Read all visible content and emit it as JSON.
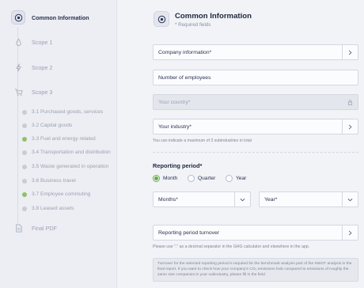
{
  "sidebar": {
    "steps": [
      {
        "label": "Common Information",
        "icon": "target-icon",
        "active": true
      },
      {
        "label": "Scope 1",
        "icon": "drop-icon",
        "active": false
      },
      {
        "label": "Scope 2",
        "icon": "lightning-icon",
        "active": false
      },
      {
        "label": "Scope 3",
        "icon": "cart-icon",
        "active": false
      },
      {
        "label": "Final PDF",
        "icon": "document-icon",
        "active": false
      }
    ],
    "scope3_items": [
      {
        "label": "3.1 Purchased goods, services",
        "done": false
      },
      {
        "label": "3.2 Capital goods",
        "done": false
      },
      {
        "label": "3.3 Fuel and energy related",
        "done": true
      },
      {
        "label": "3.4 Transportation and distribution",
        "done": false
      },
      {
        "label": "3.5 Waste generated in operation",
        "done": false
      },
      {
        "label": "3.6 Business travel",
        "done": false
      },
      {
        "label": "3.7 Employee commuting",
        "done": true
      },
      {
        "label": "3.8 Leased assets",
        "done": false
      }
    ]
  },
  "header": {
    "title": "Common Information",
    "subtitle": "* Required fields"
  },
  "form": {
    "company_info": "Company information*",
    "employees_placeholder": "Number of employees",
    "country_placeholder": "Your country*",
    "industry": "Your industry*",
    "industry_hint": "You can indicate a maximum of 3 subindustries in total",
    "period_title": "Reporting period*",
    "period_options": [
      "Month",
      "Quarter",
      "Year"
    ],
    "period_selected": "Month",
    "months_label": "Months*",
    "year_label": "Year*",
    "turnover": "Reporting period turnover",
    "turnover_hint": "Please use \".\" as a decimal separator in the GHG calculator and elsewhere in the app.",
    "note": "Turnover for the selected reporting period is required for the benchmark analysis part of the SWOT analysis in the final report. If you want to check how your company's CO₂ emissions look compared to emissions of roughly the same size companies in your subindustry, please fill in the field"
  },
  "colors": {
    "accent_green": "#6aa84a",
    "done_dot": "#8fc06a",
    "text_dark": "#1f2740"
  }
}
